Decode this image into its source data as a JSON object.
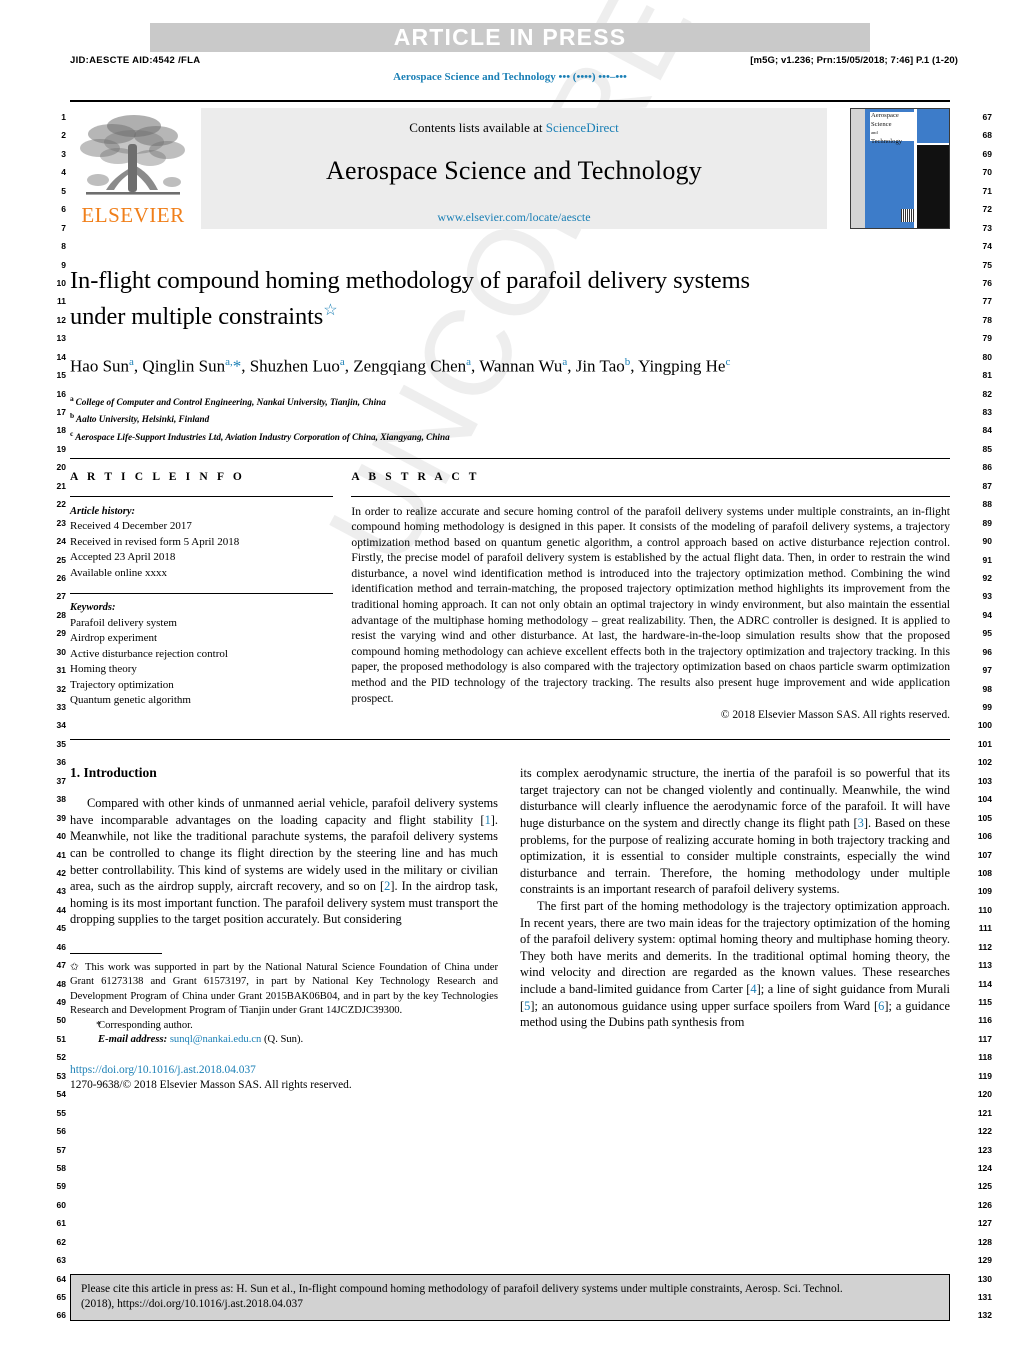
{
  "header": {
    "press_banner": "ARTICLE IN PRESS",
    "jid_line": "JID:AESCTE   AID:4542 /FLA",
    "stamp_line": "[m5G; v1.236; Prn:15/05/2018; 7:46] P.1 (1-20)",
    "running_title": "Aerospace Science and Technology ••• (••••) •••–•••"
  },
  "watermark": {
    "text": "UNCORRECTED PROOF"
  },
  "masthead": {
    "publisher": "ELSEVIER",
    "contents_prefix": "Contents lists available at ",
    "contents_link": "ScienceDirect",
    "journal_title": "Aerospace Science and Technology",
    "journal_url": "www.elsevier.com/locate/aescte",
    "cover_title_line1": "Aerospace",
    "cover_title_line2": "Science",
    "cover_title_and": "and",
    "cover_title_line3": "Technology"
  },
  "article": {
    "title_line1": "In-flight compound homing methodology of parafoil delivery systems",
    "title_line2": "under multiple constraints",
    "title_star": "☆",
    "authors": [
      {
        "name": "Hao Sun",
        "sup": "a",
        "sep": ", "
      },
      {
        "name": "Qinglin Sun",
        "sup": "a,",
        "star": "*",
        "sep": ", "
      },
      {
        "name": "Shuzhen Luo",
        "sup": "a",
        "sep": ", "
      },
      {
        "name": "Zengqiang Chen",
        "sup": "a",
        "sep": ", "
      },
      {
        "name": "Wannan Wu",
        "sup": "a",
        "sep": ", "
      },
      {
        "name": "Jin Tao",
        "sup": "b",
        "sep": ", "
      },
      {
        "name": "Yingping He",
        "sup": "c",
        "sep": ""
      }
    ],
    "affiliations": [
      {
        "mark": "a",
        "text": "College of Computer and Control Engineering, Nankai University, Tianjin, China"
      },
      {
        "mark": "b",
        "text": "Aalto University, Helsinki, Finland"
      },
      {
        "mark": "c",
        "text": "Aerospace Life-Support Industries Ltd, Aviation Industry Corporation of China, Xiangyang, China"
      }
    ]
  },
  "article_info": {
    "heading": "A R T I C L E   I N F O",
    "history_label": "Article history:",
    "history": [
      "Received 4 December 2017",
      "Received in revised form 5 April 2018",
      "Accepted 23 April 2018",
      "Available online xxxx"
    ],
    "keywords_label": "Keywords:",
    "keywords": [
      "Parafoil delivery system",
      "Airdrop experiment",
      "Active disturbance rejection control",
      "Homing theory",
      "Trajectory optimization",
      "Quantum genetic algorithm"
    ]
  },
  "abstract": {
    "heading": "A B S T R A C T",
    "text": "In order to realize accurate and secure homing control of the parafoil delivery systems under multiple constraints, an in-flight compound homing methodology is designed in this paper. It consists of the modeling of parafoil delivery systems, a trajectory optimization method based on quantum genetic algorithm, a control approach based on active disturbance rejection control. Firstly, the precise model of parafoil delivery system is established by the actual flight data. Then, in order to restrain the wind disturbance, a novel wind identification method is introduced into the trajectory optimization method. Combining the wind identification method and terrain-matching, the proposed trajectory optimization method highlights its improvement from the traditional homing approach. It can not only obtain an optimal trajectory in windy environment, but also maintain the essential advantage of the multiphase homing methodology – great realizability. Then, the ADRC controller is designed. It is applied to resist the varying wind and other disturbance. At last, the hardware-in-the-loop simulation results show that the proposed compound homing methodology can achieve excellent effects both in the trajectory optimization and trajectory tracking. In this paper, the proposed methodology is also compared with the trajectory optimization based on chaos particle swarm optimization method and the PID technology of the trajectory tracking. The results also present huge improvement and wide application prospect.",
    "copyright": "© 2018 Elsevier Masson SAS. All rights reserved."
  },
  "introduction": {
    "heading": "1. Introduction",
    "left_paragraph_1_a": "Compared with other kinds of unmanned aerial vehicle, parafoil delivery systems have incomparable advantages on the loading capacity and flight stability [",
    "left_ref_1": "1",
    "left_paragraph_1_b": "]. Meanwhile, not like the traditional parachute systems, the parafoil delivery systems can be controlled to change its flight direction by the steering line and has much better controllability. This kind of systems are widely used in the military or civilian area, such as the airdrop supply, aircraft recovery, and so on [",
    "left_ref_2": "2",
    "left_paragraph_1_c": "]. In the airdrop task, homing is its most important function. The parafoil delivery system must transport the dropping supplies to the target position accurately. But considering",
    "right_paragraph_1_a": "its complex aerodynamic structure, the inertia of the parafoil is so powerful that its target trajectory can not be changed violently and continually. Meanwhile, the wind disturbance will clearly influence the aerodynamic force of the parafoil. It will have huge disturbance on the system and directly change its flight path [",
    "right_ref_3": "3",
    "right_paragraph_1_b": "]. Based on these problems, for the purpose of realizing accurate homing in both trajectory tracking and optimization, it is essential to consider multiple constraints, especially the wind disturbance and terrain. Therefore, the homing methodology under multiple constraints is an important research of parafoil delivery systems.",
    "right_paragraph_2_a": "The first part of the homing methodology is the trajectory optimization approach. In recent years, there are two main ideas for the trajectory optimization of the homing of the parafoil delivery system: optimal homing theory and multiphase homing theory. They both have merits and demerits. In the traditional optimal homing theory, the wind velocity and direction are regarded as the known values. These researches include a band-limited guidance from Carter [",
    "right_ref_4": "4",
    "right_paragraph_2_b": "]; a line of sight guidance from Murali [",
    "right_ref_5": "5",
    "right_paragraph_2_c": "]; an autonomous guidance using upper surface spoilers from Ward [",
    "right_ref_6": "6",
    "right_paragraph_2_d": "]; a guidance method using the Dubins path synthesis from"
  },
  "footnotes": {
    "funding_mark": "✩",
    "funding": "This work was supported in part by the National Natural Science Foundation of China under Grant 61273138 and Grant 61573197, in part by National Key Technology Research and Development Program of China under Grant 2015BAK06B04, and in part by the key Technologies Research and Development Program of Tianjin under Grant 14JCZDJC39300.",
    "corresponding_mark": "*",
    "corresponding": "Corresponding author.",
    "email_label": "E-mail address:",
    "email": "sunql@nankai.edu.cn",
    "email_suffix": "(Q. Sun).",
    "doi": "https://doi.org/10.1016/j.ast.2018.04.037",
    "issn": "1270-9638/© 2018 Elsevier Masson SAS. All rights reserved."
  },
  "cite_box": {
    "line1": "Please cite this article in press as: H. Sun et al., In-flight compound homing methodology of parafoil delivery systems under multiple constraints, Aerosp. Sci. Technol.",
    "line2": "(2018), https://doi.org/10.1016/j.ast.2018.04.037"
  },
  "line_numbers": {
    "left_start": 1,
    "left_end": 66,
    "right_start": 67,
    "right_end": 132
  },
  "colors": {
    "link": "#1a7fb5",
    "banner_bg": "#c9c9c9",
    "masthead_bg": "#ececec",
    "elsevier_orange": "#f07f1a",
    "cover_blue": "#3d7cc9",
    "cite_box_bg": "#d2d2d2"
  }
}
